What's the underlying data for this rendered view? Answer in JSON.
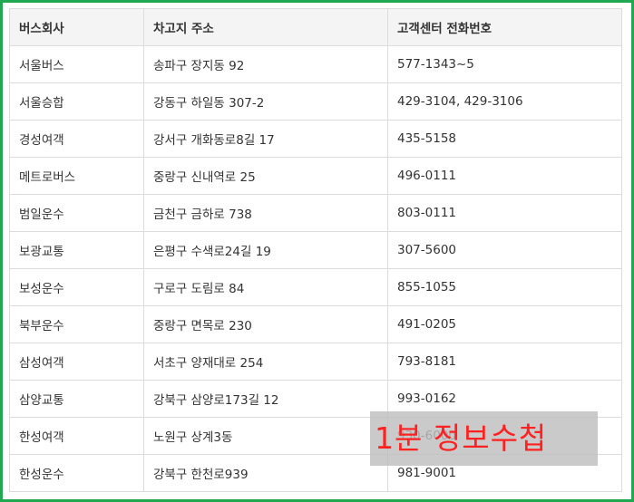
{
  "table": {
    "headers": [
      "버스회사",
      "차고지 주소",
      "고객센터 전화번호"
    ],
    "rows": [
      [
        "서울버스",
        "송파구 장지동 92",
        "577-1343~5"
      ],
      [
        "서울승합",
        "강동구 하일동 307-2",
        "429-3104, 429-3106"
      ],
      [
        "경성여객",
        "강서구 개화동로8길 17",
        "435-5158"
      ],
      [
        "메트로버스",
        "중랑구 신내역로 25",
        "496-0111"
      ],
      [
        "범일운수",
        "금천구 금하로 738",
        "803-0111"
      ],
      [
        "보광교통",
        "은평구 수색로24길 19",
        "307-5600"
      ],
      [
        "보성운수",
        "구로구 도림로 84",
        "855-1055"
      ],
      [
        "북부운수",
        "중랑구 면목로 230",
        "491-0205"
      ],
      [
        "삼성여객",
        "서초구 양재대로 254",
        "793-8181"
      ],
      [
        "삼양교통",
        "강북구 삼양로173길 12",
        "993-0162"
      ],
      [
        "한성여객",
        "노원구 상계3동",
        "930-6000"
      ],
      [
        "한성운수",
        "강북구 한천로939",
        "981-9001"
      ]
    ]
  },
  "watermark": {
    "text": "1분 정보수첩"
  },
  "colors": {
    "border": "#1fa84f",
    "header_bg": "#f4f4f4",
    "watermark_text": "#ff2020"
  }
}
